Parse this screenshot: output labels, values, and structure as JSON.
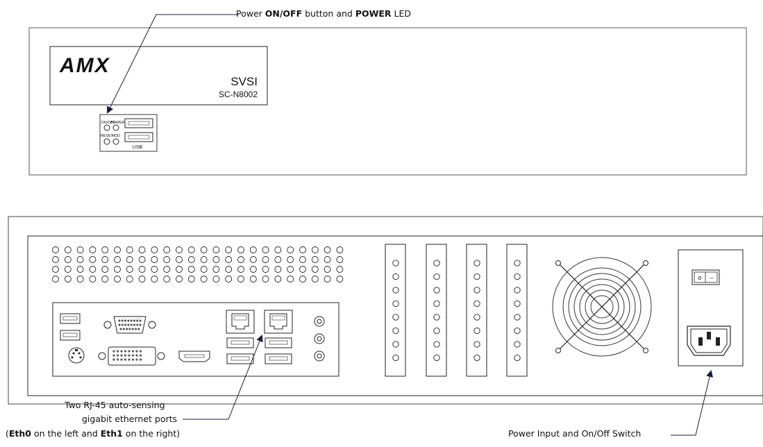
{
  "front_panel": {
    "logo": "AMX",
    "brand": "SVSI",
    "model": "SC-N8002",
    "led_labels": {
      "on_off": "ON/OFF",
      "power": "POWER",
      "reset": "RESET",
      "hdd": "HDD"
    },
    "usb_label": "USB"
  },
  "callouts": {
    "power_button": {
      "pre": "Power ",
      "b1": "ON/OFF",
      "mid": " button and ",
      "b2": "POWER",
      "post": " LED"
    },
    "ethernet": {
      "line1": "Two RJ-45 auto-sensing",
      "line2": "gigabit ethernet ports",
      "line3": {
        "open": "(",
        "b1": "Eth0",
        "mid": " on the left and ",
        "b2": "Eth1",
        "post": " on the right)"
      }
    },
    "power_input": "Power Input and On/Off Switch"
  },
  "power_switch": {
    "off_symbol": "o",
    "on_symbol": "–"
  }
}
